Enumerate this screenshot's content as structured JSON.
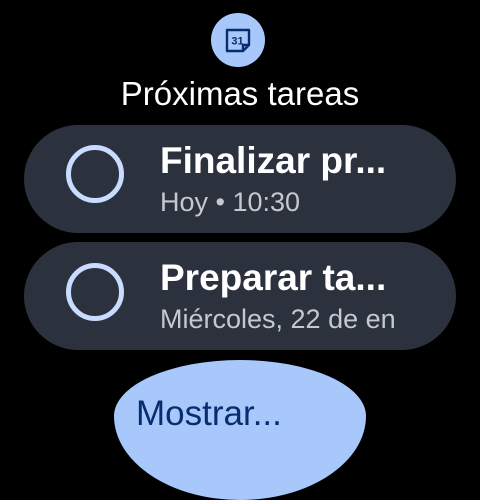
{
  "header": {
    "app_icon": "calendar-icon",
    "calendar_day": "31",
    "title": "Próximas tareas"
  },
  "tasks": [
    {
      "title": "Finalizar pr...",
      "subtitle": "Hoy • 10:30",
      "icon": "unchecked-circle-icon"
    },
    {
      "title": "Preparar ta...",
      "subtitle": "Miércoles, 22 de en",
      "icon": "unchecked-circle-icon"
    }
  ],
  "footer": {
    "show_more_label": "Mostrar..."
  },
  "colors": {
    "background": "#000000",
    "chip": "#2b313d",
    "accent": "#a8c7fa",
    "circle": "#c9dcff",
    "button_text": "#062e6f"
  }
}
